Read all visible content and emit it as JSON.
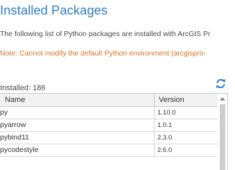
{
  "page": {
    "title": "Installed Packages",
    "description": "The following list of Python packages are installed with ArcGIS Pr",
    "note": "Note: Cannot modify the default Python environment (arcgispro-"
  },
  "packages": {
    "count_label": "Installed: 186",
    "columns": {
      "name": "Name",
      "version": "Version"
    },
    "rows": [
      {
        "name": "py",
        "version": "1.10.0"
      },
      {
        "name": "pyarrow",
        "version": "1.0.1"
      },
      {
        "name": "pybind11",
        "version": "2.3.0"
      },
      {
        "name": "pycodestyle",
        "version": "2.6.0"
      }
    ]
  },
  "icons": {
    "refresh": "refresh-icon",
    "scroll_up": "chevron-up-icon"
  },
  "colors": {
    "title": "#2f7dc5",
    "note": "#d9711f",
    "refresh": "#2f7dc5"
  }
}
